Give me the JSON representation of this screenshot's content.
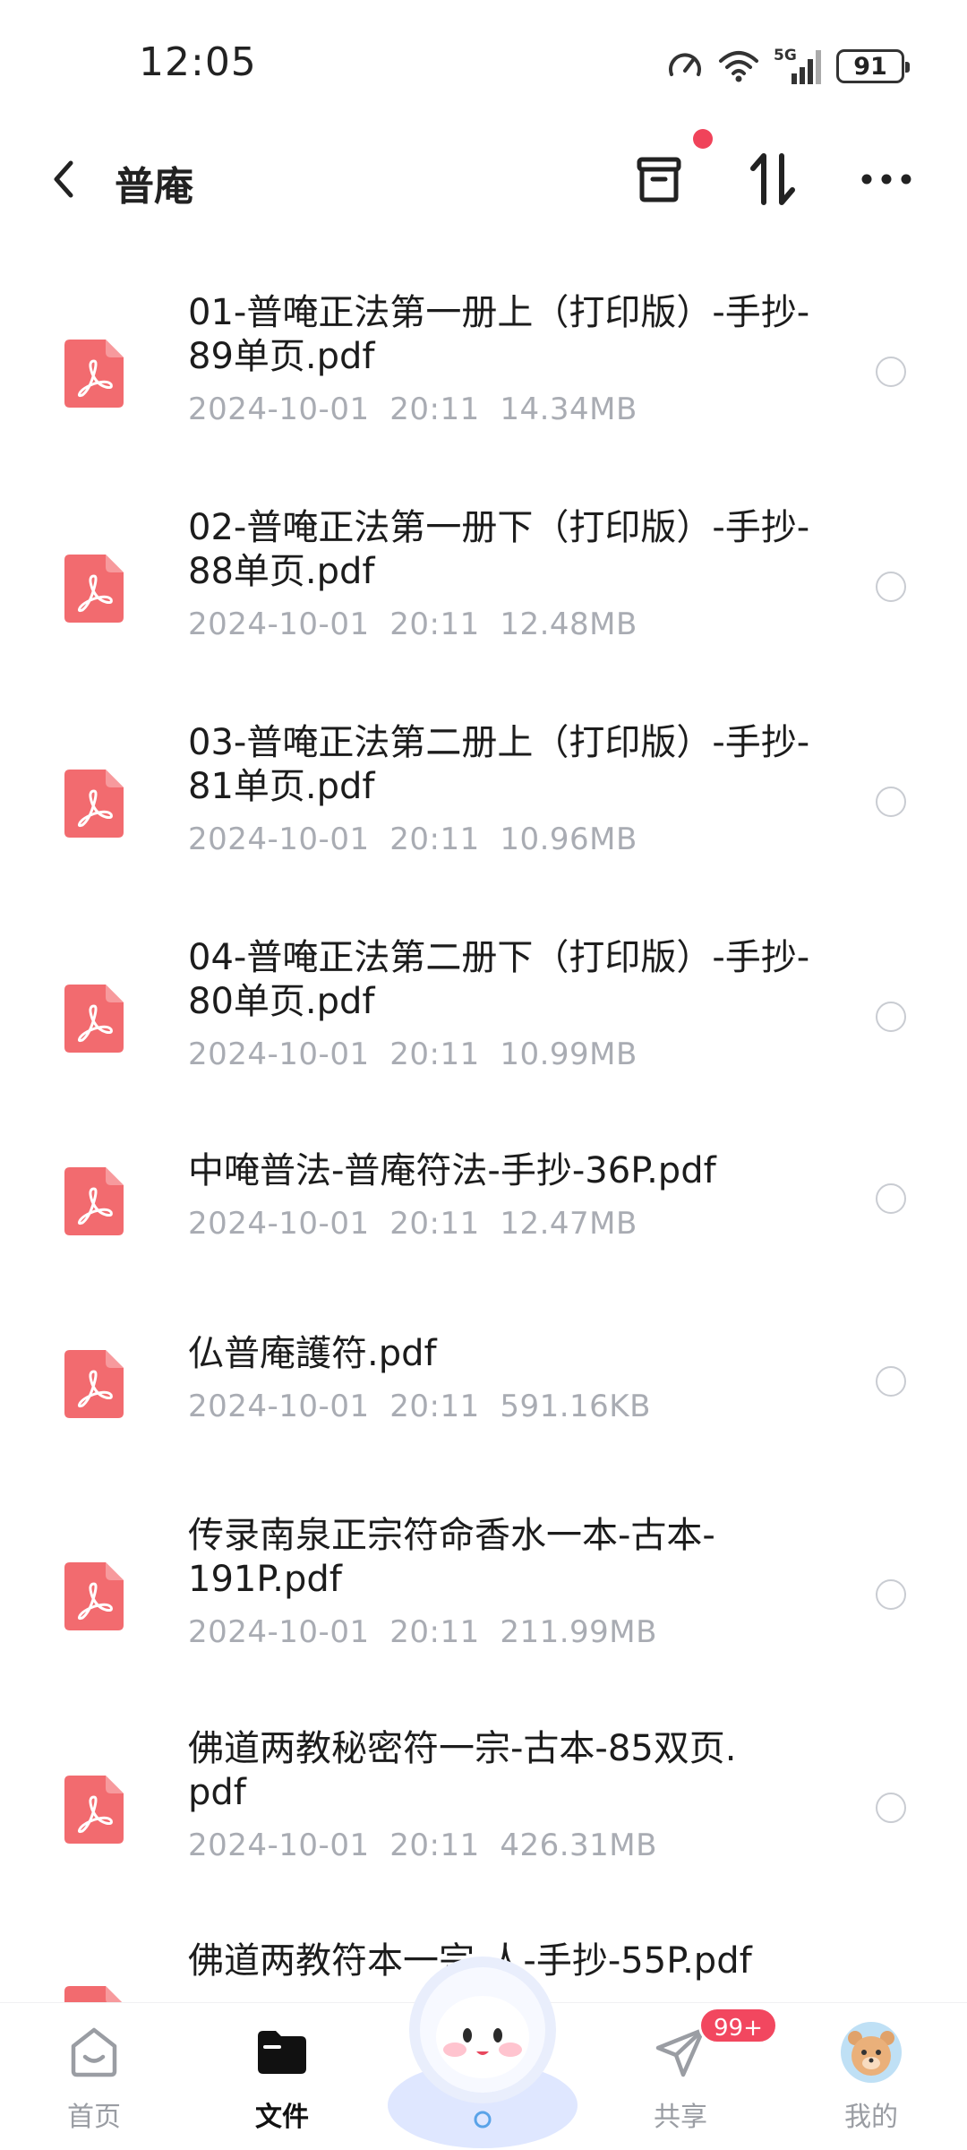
{
  "status_bar": {
    "time": "12:05",
    "network": "5G",
    "battery": "91",
    "icons": [
      "speed-icon",
      "wifi-icon",
      "signal-icon",
      "battery-icon"
    ]
  },
  "header": {
    "title": "普庵",
    "icons": [
      "back-icon",
      "recycle-bin-icon",
      "sort-icon",
      "more-icon"
    ]
  },
  "files": [
    {
      "name": "01-普唵正法第一册上（打印版）-手抄-89单页.pdf",
      "date": "2024-10-01",
      "time": "20:11",
      "size": "14.34MB"
    },
    {
      "name": "02-普唵正法第一册下（打印版）-手抄-88单页.pdf",
      "date": "2024-10-01",
      "time": "20:11",
      "size": "12.48MB"
    },
    {
      "name": "03-普唵正法第二册上（打印版）-手抄-81单页.pdf",
      "date": "2024-10-01",
      "time": "20:11",
      "size": "10.96MB"
    },
    {
      "name": "04-普唵正法第二册下（打印版）-手抄-80单页.pdf",
      "date": "2024-10-01",
      "time": "20:11",
      "size": "10.99MB"
    },
    {
      "name": "中唵普法-普庵符法-手抄-36P.pdf",
      "date": "2024-10-01",
      "time": "20:11",
      "size": "12.47MB"
    },
    {
      "name": "仏普庵護符.pdf",
      "date": "2024-10-01",
      "time": "20:11",
      "size": "591.16KB"
    },
    {
      "name": "传录南泉正宗符命香水一本-古本-191P.pdf",
      "date": "2024-10-01",
      "time": "20:11",
      "size": "211.99MB"
    },
    {
      "name": "佛道两教秘密符一宗-古本-85双页.pdf",
      "date": "2024-10-01",
      "time": "20:11",
      "size": "426.31MB"
    },
    {
      "name": "佛道两教符本一宗-人-手抄-55P.pdf",
      "date": "",
      "time": "",
      "size": ""
    }
  ],
  "bottom_nav": {
    "items": [
      {
        "label": "首页",
        "icon": "home-icon"
      },
      {
        "label": "文件",
        "icon": "folder-icon",
        "active": true
      },
      {
        "label": "共享",
        "icon": "share-icon"
      },
      {
        "label": "我的",
        "icon": "avatar-icon"
      }
    ],
    "share_badge": "99+"
  },
  "colors": {
    "pdf_icon": "#f26b6f",
    "accent_red": "#f0435a",
    "meta_gray": "#a9acb3"
  }
}
